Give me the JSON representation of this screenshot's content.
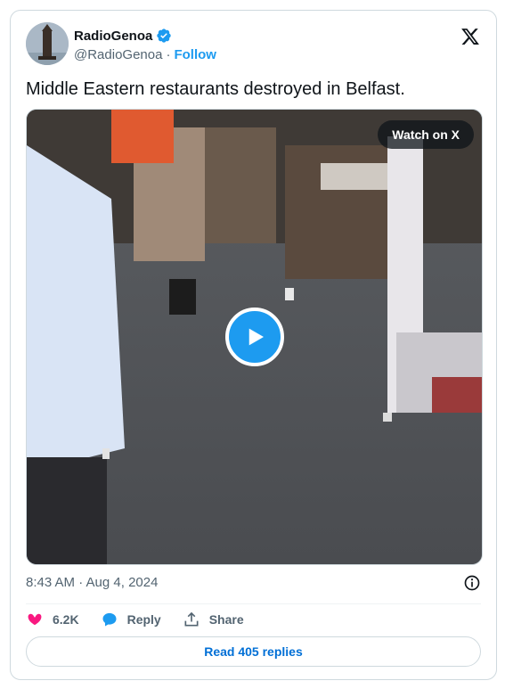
{
  "author": {
    "display_name": "RadioGenoa",
    "handle": "@RadioGenoa",
    "separator": "·",
    "follow_label": "Follow",
    "verified_color": "#1d9bf0"
  },
  "tweet": {
    "text": "Middle Eastern restaurants destroyed in Belfast.",
    "timestamp": "8:43 AM · Aug 4, 2024"
  },
  "media": {
    "watch_label": "Watch on X"
  },
  "actions": {
    "likes": "6.2K",
    "reply_label": "Reply",
    "share_label": "Share"
  },
  "read_replies_label": "Read 405 replies",
  "colors": {
    "accent": "#1d9bf0",
    "like": "#f91880",
    "link": "#006fd6",
    "muted": "#536471"
  },
  "icons": [
    "x-logo-icon",
    "verified-badge-icon",
    "play-icon",
    "info-icon",
    "heart-icon",
    "reply-bubble-icon",
    "share-upload-icon"
  ]
}
